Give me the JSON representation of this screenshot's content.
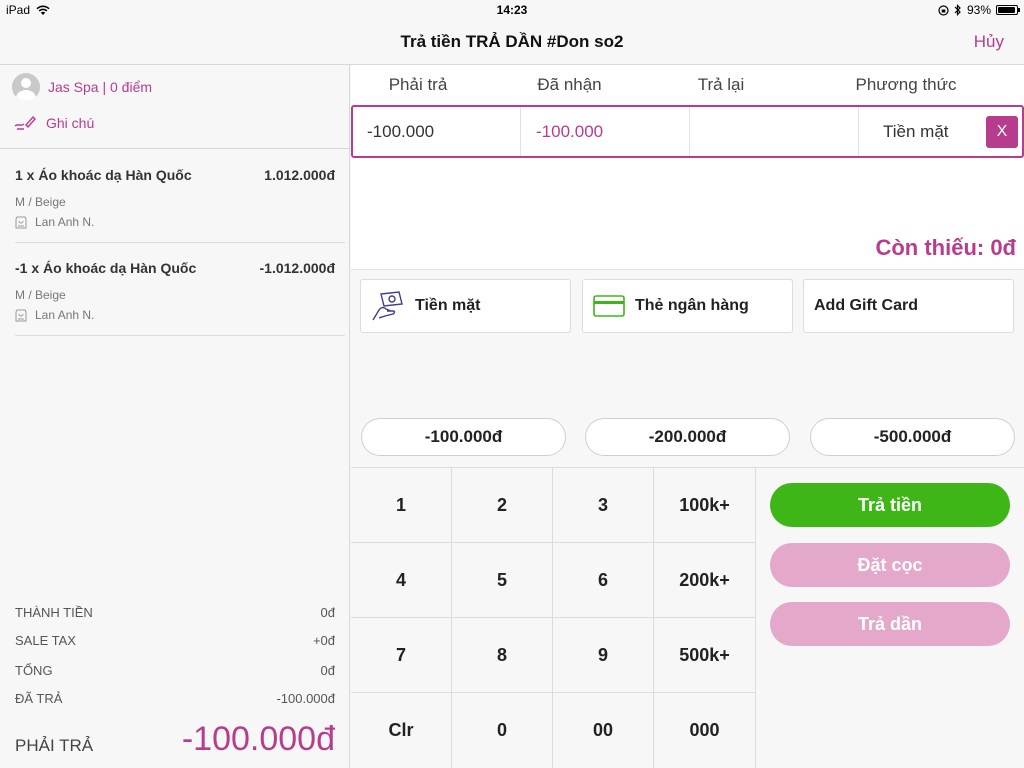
{
  "status": {
    "device": "iPad",
    "time": "14:23",
    "battery": "93%"
  },
  "nav": {
    "title": "Trả tiền TRẢ DẦN #Don so2",
    "cancel": "Hủy"
  },
  "customer": {
    "name": "Jas Spa | 0 điểm"
  },
  "note": {
    "label": "Ghi chú"
  },
  "items": [
    {
      "name": "1 x Áo khoác dạ Hàn Quốc",
      "price": "1.012.000đ",
      "variant": "M / Beige",
      "staff": "Lan Anh N."
    },
    {
      "name": "-1 x Áo khoác dạ Hàn Quốc",
      "price": "-1.012.000đ",
      "variant": "M / Beige",
      "staff": "Lan Anh N."
    }
  ],
  "totals": {
    "subtotal": {
      "label": "THÀNH TIỀN",
      "value": "0đ"
    },
    "tax": {
      "label": "SALE TAX",
      "value": "+0đ"
    },
    "total": {
      "label": "TỔNG",
      "value": "0đ"
    },
    "paid": {
      "label": "ĐÃ TRẢ",
      "value": "-100.000đ"
    },
    "due": {
      "label": "PHẢI TRẢ",
      "value": "-100.000đ"
    }
  },
  "table": {
    "headers": {
      "must_pay": "Phải trả",
      "received": "Đã nhận",
      "change": "Trả lại",
      "method": "Phương thức"
    },
    "row": {
      "must_pay": "-100.000",
      "received": "-100.000",
      "change": "",
      "method": "Tiền mặt",
      "remove": "X"
    }
  },
  "remaining": "Còn thiếu: 0đ",
  "methods": [
    {
      "label": "Tiền mặt",
      "icon": "cash-icon"
    },
    {
      "label": "Thẻ ngân hàng",
      "icon": "bank-card-icon"
    },
    {
      "label": "Add Gift Card"
    }
  ],
  "quick_amounts": [
    "-100.000đ",
    "-200.000đ",
    "-500.000đ"
  ],
  "keypad": [
    "1",
    "2",
    "3",
    "100k+",
    "4",
    "5",
    "6",
    "200k+",
    "7",
    "8",
    "9",
    "500k+",
    "Clr",
    "0",
    "00",
    "000"
  ],
  "actions": {
    "pay": "Trả tiền",
    "deposit": "Đặt cọc",
    "installment": "Trả dần"
  },
  "colors": {
    "accent": "#b83c8e",
    "pay_green": "#3fb618",
    "disabled_pink": "#e4a8cb"
  }
}
